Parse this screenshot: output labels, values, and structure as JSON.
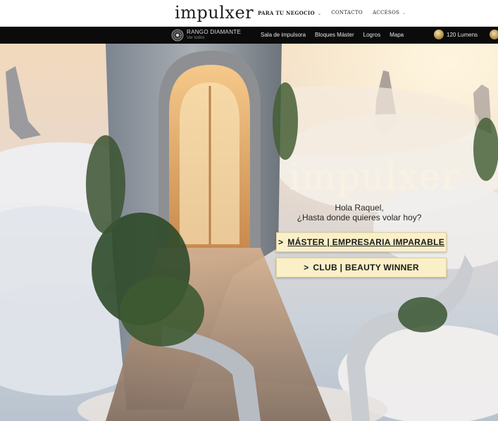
{
  "header": {
    "logo": "impulxer",
    "nav": [
      {
        "label": "PARA TU NEGOCIO",
        "dropdown": true
      },
      {
        "label": "CONTACTO",
        "dropdown": false
      },
      {
        "label": "ACCESOS",
        "dropdown": true
      }
    ]
  },
  "subbar": {
    "rank_title": "RANGO DIAMANTE",
    "rank_sub": "Ver todos",
    "links": [
      "Sala de impulsora",
      "Bloques Máster",
      "Logros",
      "Mapa"
    ],
    "lumens": "120 Lumens"
  },
  "hero": {
    "logo": "impulxer",
    "greeting_line1": "Hola Raquel,",
    "greeting_line2": "¿Hasta donde quieres volar hoy?",
    "cta_master": "MÁSTER | EMPRESARIA IMPARABLE",
    "cta_club": "CLUB | BEAUTY WINNER",
    "cta_arrow": ">"
  },
  "colors": {
    "cta_bg": "#faf0c8",
    "dark_bar": "#0b0b0b",
    "sky": "#f4dcc0"
  },
  "icons": [
    "diamond-rank-icon",
    "lumens-coin-icon",
    "avatar-icon",
    "chevron-down-icon"
  ]
}
